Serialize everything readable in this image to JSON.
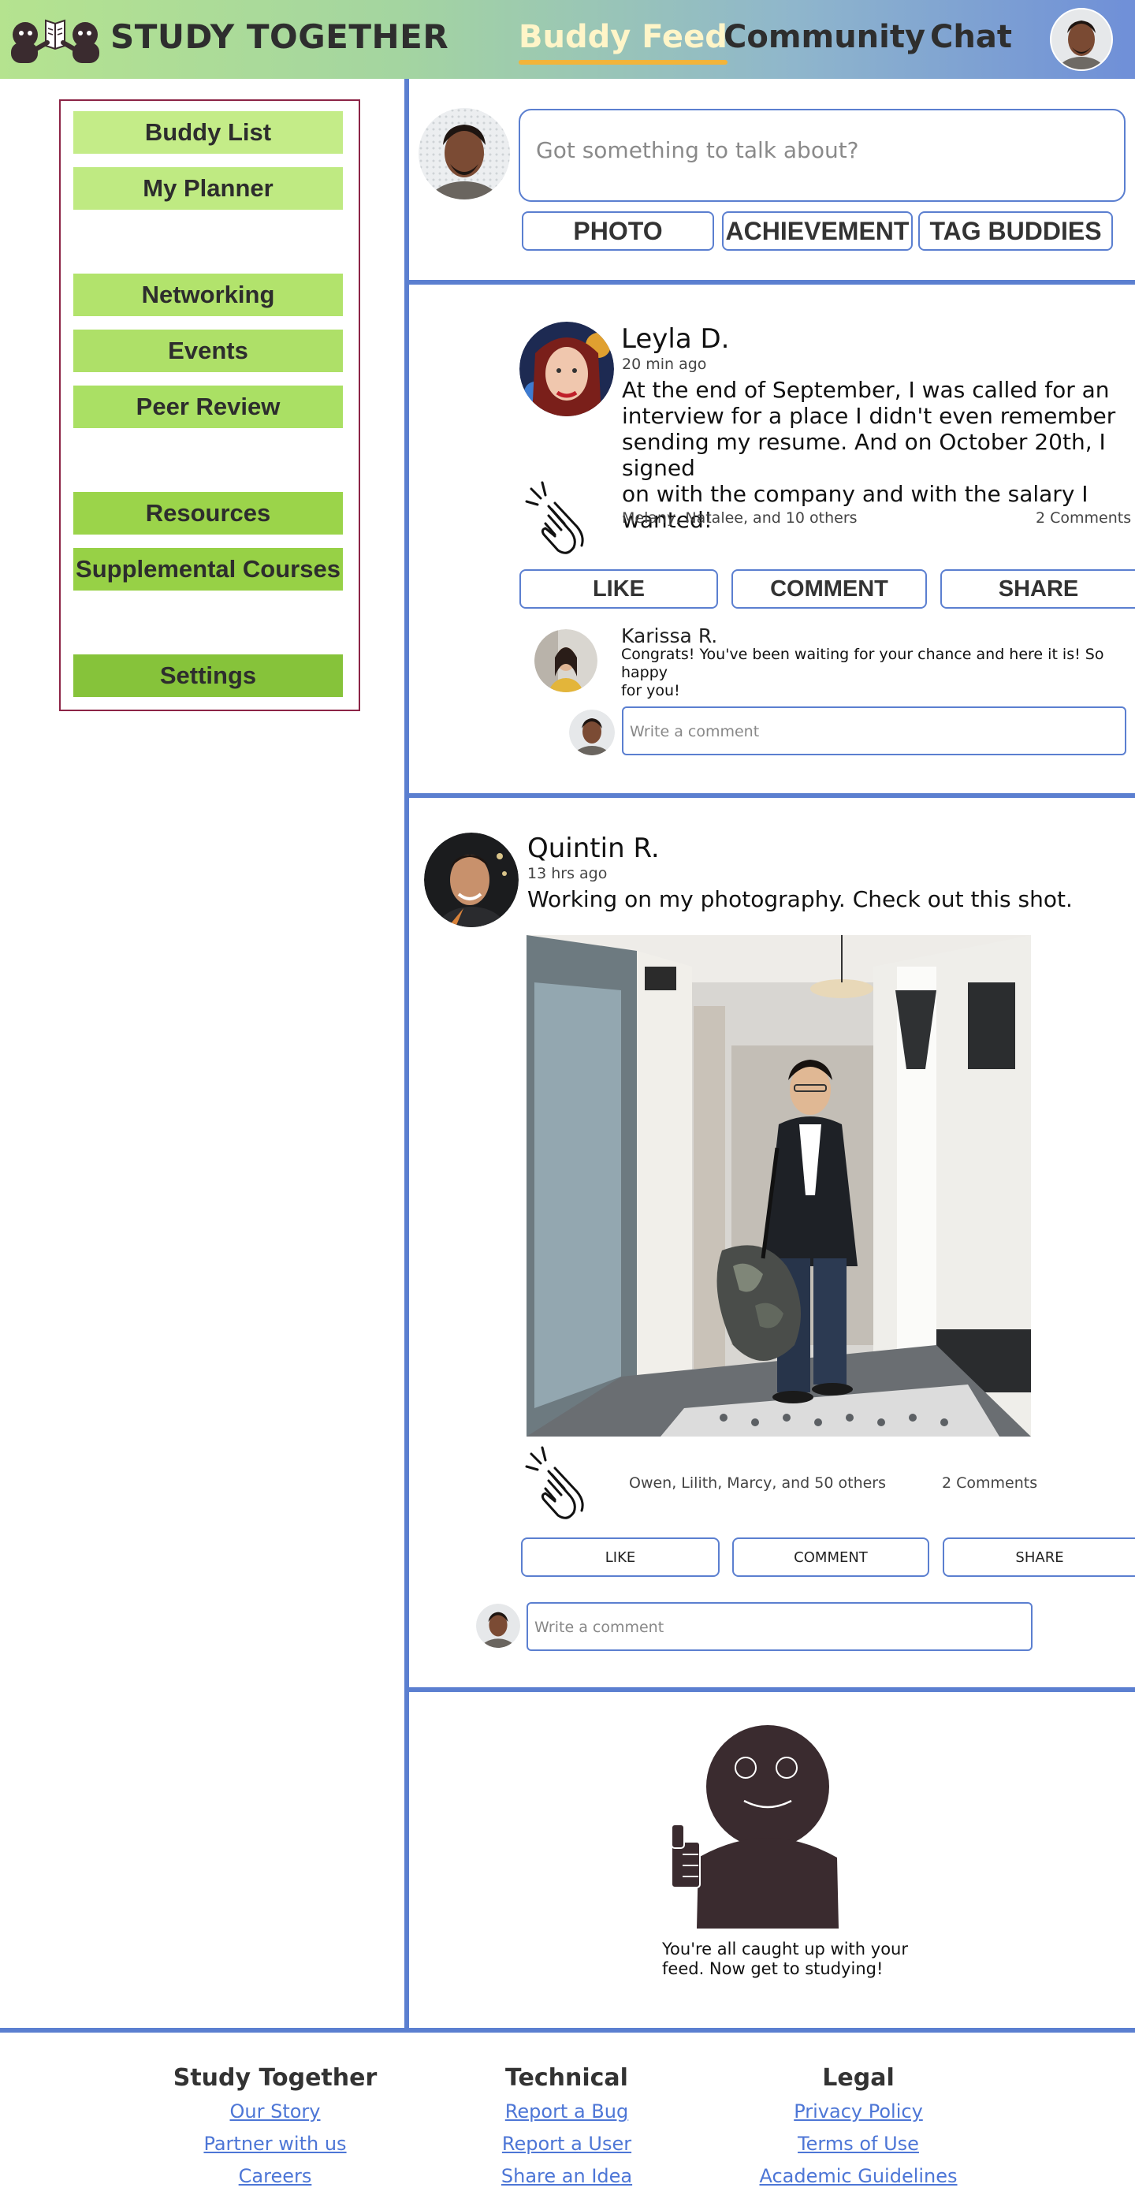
{
  "header": {
    "brand": "STUDY TOGETHER",
    "nav": [
      {
        "label": "Buddy Feed",
        "active": true
      },
      {
        "label": "Community",
        "active": false
      },
      {
        "label": "Chat",
        "active": false
      }
    ]
  },
  "sidebar": {
    "items": [
      {
        "label": "Buddy List",
        "color": "#c4ec88"
      },
      {
        "label": "My Planner",
        "color": "#bfea82"
      },
      {
        "label": "Networking",
        "color": "#b2e36c"
      },
      {
        "label": "Events",
        "color": "#aee068"
      },
      {
        "label": "Peer Review",
        "color": "#aae064"
      },
      {
        "label": "Resources",
        "color": "#9bd44a"
      },
      {
        "label": "Supplemental Courses",
        "color": "#97d146"
      },
      {
        "label": "Settings",
        "color": "#86c33a"
      }
    ]
  },
  "composer": {
    "placeholder": "Got something to talk about?",
    "buttons": [
      "PHOTO",
      "ACHIEVEMENT",
      "TAG BUDDIES"
    ]
  },
  "posts": [
    {
      "author": "Leyla D.",
      "time": "20 min ago",
      "text_lines": [
        "At the end of September, I was called for an",
        "interview for a place I didn't even remember",
        "sending my resume. And on October 20th, I signed",
        "on with the company and with the salary I wanted!"
      ],
      "reactions": "Melany, Natalee, and 10 others",
      "comments_count": "2 Comments",
      "actions": [
        "LIKE",
        "COMMENT",
        "SHARE"
      ],
      "comment": {
        "author": "Karissa R.",
        "text_lines": [
          "Congrats! You've been waiting for your chance and here it is! So happy",
          "for you!"
        ]
      },
      "comment_placeholder": "Write a comment"
    },
    {
      "author": "Quintin R.",
      "time": "13 hrs ago",
      "text": "Working on my photography. Check out this shot.",
      "reactions": "Owen, Lilith, Marcy, and 50 others",
      "comments_count": "2 Comments",
      "actions": [
        "LIKE",
        "COMMENT",
        "SHARE"
      ],
      "comment_placeholder": "Write a comment"
    }
  ],
  "caught_up": {
    "line1": "You're all caught up with your",
    "line2": "feed. Now get to studying!"
  },
  "footer": {
    "columns": [
      {
        "heading": "Study Together",
        "links": [
          "Our Story",
          "Partner with us",
          "Careers"
        ]
      },
      {
        "heading": "Technical",
        "links": [
          "Report a Bug",
          "Report a User",
          "Share an Idea"
        ]
      },
      {
        "heading": "Legal",
        "links": [
          "Privacy Policy",
          "Terms of Use",
          "Academic Guidelines"
        ]
      }
    ]
  },
  "colors": {
    "accent_blue": "#5b7fd0",
    "link_blue": "#4d76d6",
    "nav_active_underline": "#f2b43a",
    "sidebar_border": "#8c2446",
    "mascot": "#3a2b2f"
  }
}
